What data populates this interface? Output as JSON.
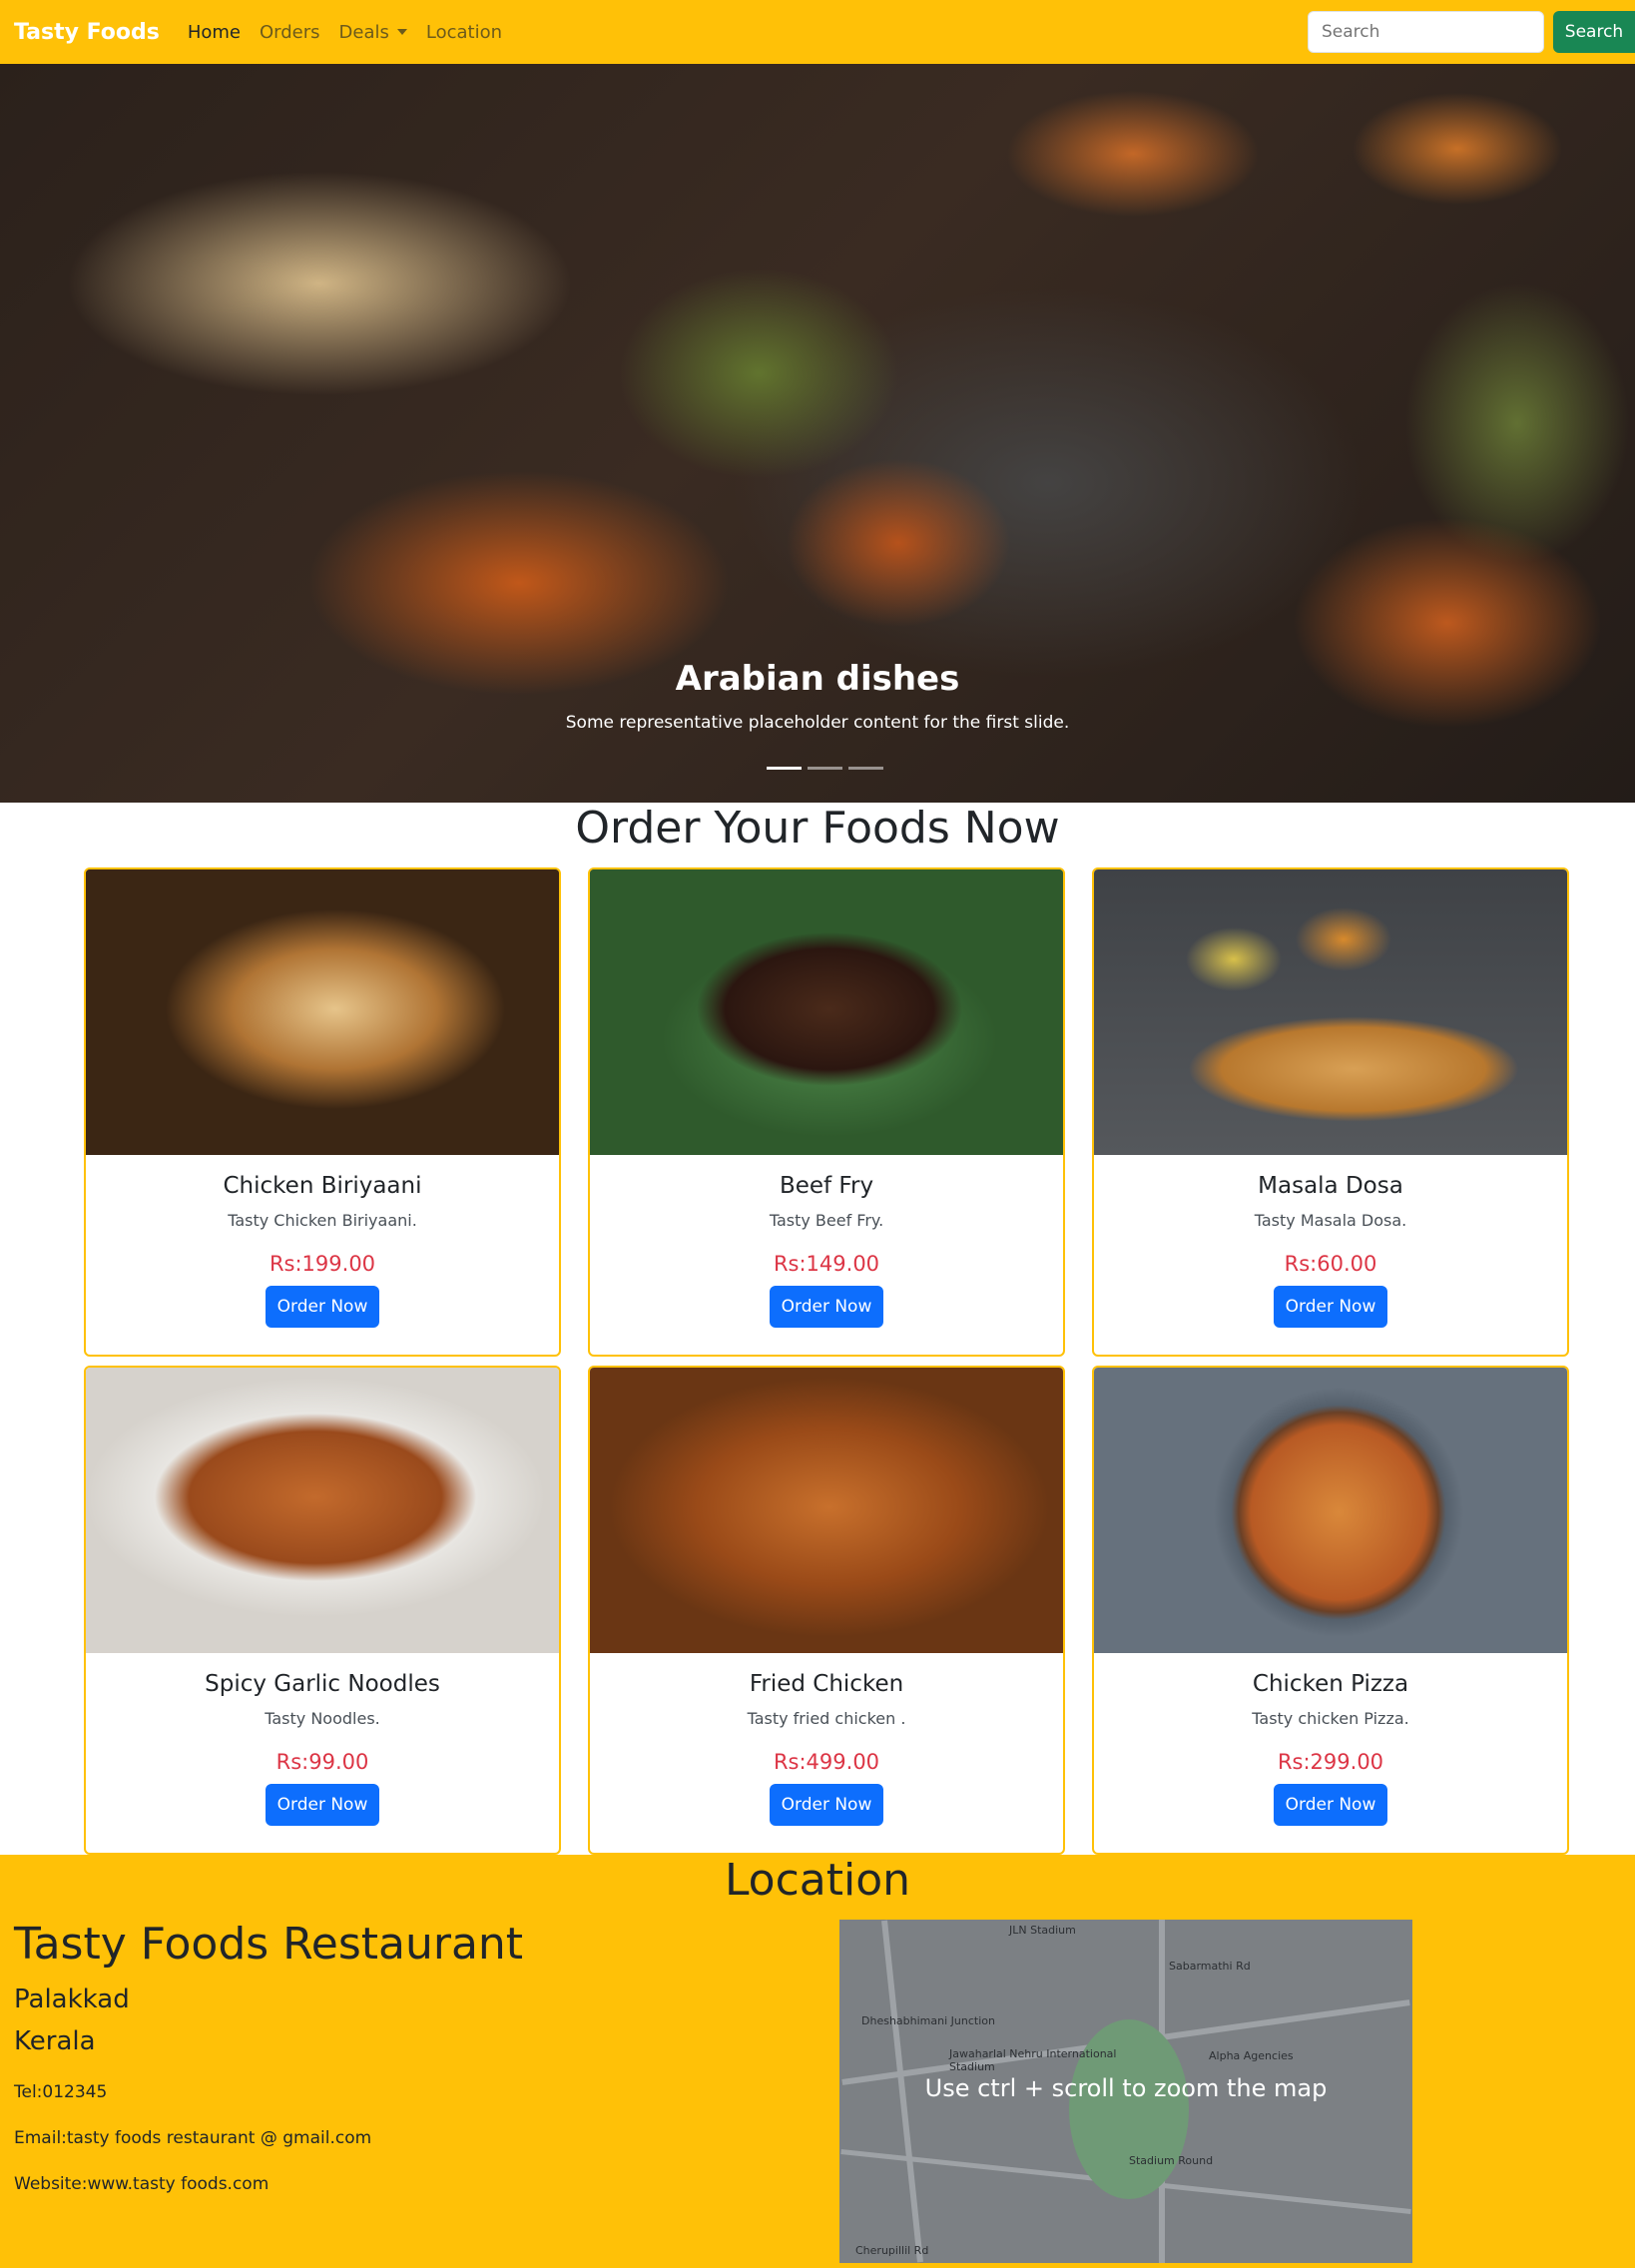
{
  "navbar": {
    "brand": "Tasty Foods",
    "links": [
      "Home",
      "Orders",
      "Deals",
      "Location"
    ],
    "search_placeholder": "Search",
    "search_button": "Search"
  },
  "hero": {
    "title": "Arabian dishes",
    "subtitle": "Some representative placeholder content for the first slide.",
    "slides": 3,
    "active_slide": 1
  },
  "order_section": {
    "title": "Order Your Foods Now",
    "cards": [
      {
        "name": "Chicken Biriyaani",
        "desc": "Tasty Chicken Biriyaani.",
        "price": "Rs:199.00",
        "button": "Order Now"
      },
      {
        "name": "Beef Fry",
        "desc": "Tasty Beef Fry.",
        "price": "Rs:149.00",
        "button": "Order Now"
      },
      {
        "name": "Masala Dosa",
        "desc": "Tasty Masala Dosa.",
        "price": "Rs:60.00",
        "button": "Order Now"
      },
      {
        "name": "Spicy Garlic Noodles",
        "desc": "Tasty Noodles.",
        "price": "Rs:99.00",
        "button": "Order Now"
      },
      {
        "name": "Fried Chicken",
        "desc": "Tasty fried chicken .",
        "price": "Rs:499.00",
        "button": "Order Now"
      },
      {
        "name": "Chicken Pizza",
        "desc": "Tasty chicken Pizza.",
        "price": "Rs:299.00",
        "button": "Order Now"
      }
    ]
  },
  "location": {
    "title": "Location",
    "restaurant": "Tasty Foods Restaurant",
    "city": "Palakkad",
    "state": "Kerala",
    "tel": "Tel:012345",
    "email": "Email:tasty foods restaurant @ gmail.com",
    "website": "Website:www.tasty foods.com",
    "map_overlay": "Use ctrl + scroll to zoom the map",
    "map_labels": [
      "JLN Stadium",
      "Jawaharlal Nehru International Stadium",
      "Alpha Agencies",
      "Stadium Round",
      "Sabarmathi Rd",
      "Cherupillil Rd",
      "Dheshabhimani Junction"
    ]
  },
  "colors": {
    "brand_yellow": "#ffc107",
    "primary_blue": "#0d6efd",
    "success_green": "#198754",
    "price_red": "#dc3545"
  }
}
